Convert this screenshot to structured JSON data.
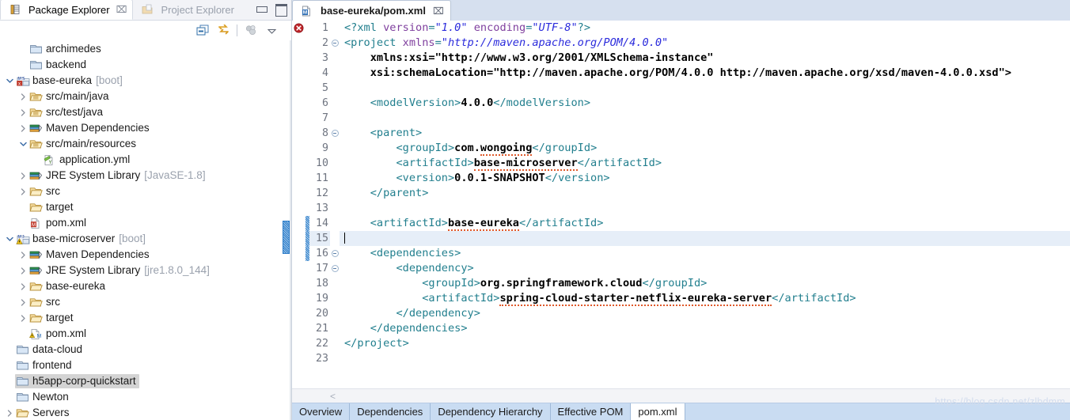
{
  "explorer": {
    "tabs": [
      {
        "label": "Package Explorer",
        "active": true,
        "icon": "package-explorer-icon",
        "close": "⌧"
      },
      {
        "label": "Project Explorer",
        "active": false,
        "icon": "project-explorer-icon",
        "close": "⌧"
      }
    ],
    "window_buttons": [
      {
        "name": "minimize-button",
        "label": ""
      },
      {
        "name": "maximize-button",
        "label": ""
      }
    ],
    "toolbar": [
      {
        "name": "collapse-all-button",
        "title": "Collapse All"
      },
      {
        "name": "link-with-editor-button",
        "title": "Link with Editor"
      },
      {
        "name": "focus-on-active-task-button",
        "title": "Focus on Active Task"
      },
      {
        "name": "view-menu-button",
        "title": "View Menu"
      }
    ],
    "tree": [
      {
        "indent": 1,
        "arrow": "none",
        "icon": "folder-closed-icon",
        "label": "archimedes",
        "sub": "",
        "selected": false
      },
      {
        "indent": 1,
        "arrow": "none",
        "icon": "folder-closed-icon",
        "label": "backend",
        "sub": "",
        "selected": false
      },
      {
        "indent": 0,
        "arrow": "expanded",
        "icon": "maven-spring-project-icon",
        "label": "base-eureka",
        "sub": "[boot]",
        "selected": false
      },
      {
        "indent": 1,
        "arrow": "collapsed",
        "icon": "source-folder-icon",
        "label": "src/main/java",
        "sub": "",
        "selected": false
      },
      {
        "indent": 1,
        "arrow": "collapsed",
        "icon": "source-folder-icon",
        "label": "src/test/java",
        "sub": "",
        "selected": false
      },
      {
        "indent": 1,
        "arrow": "collapsed",
        "icon": "library-icon",
        "label": "Maven Dependencies",
        "sub": "",
        "selected": false
      },
      {
        "indent": 1,
        "arrow": "expanded",
        "icon": "source-folder-icon",
        "label": "src/main/resources",
        "sub": "",
        "selected": false
      },
      {
        "indent": 2,
        "arrow": "none",
        "icon": "yaml-file-icon",
        "label": "application.yml",
        "sub": "",
        "selected": false
      },
      {
        "indent": 1,
        "arrow": "collapsed",
        "icon": "library-icon",
        "label": "JRE System Library",
        "sub": "[JavaSE-1.8]",
        "selected": false
      },
      {
        "indent": 1,
        "arrow": "collapsed",
        "icon": "folder-open-icon",
        "label": "src",
        "sub": "",
        "selected": false
      },
      {
        "indent": 1,
        "arrow": "none",
        "icon": "folder-open-icon",
        "label": "target",
        "sub": "",
        "selected": false
      },
      {
        "indent": 1,
        "arrow": "none",
        "icon": "maven-pom-icon",
        "label": "pom.xml",
        "sub": "",
        "selected": false
      },
      {
        "indent": 0,
        "arrow": "expanded",
        "icon": "maven-warn-project-icon",
        "label": "base-microserver",
        "sub": "[boot]",
        "selected": false
      },
      {
        "indent": 1,
        "arrow": "collapsed",
        "icon": "library-icon",
        "label": "Maven Dependencies",
        "sub": "",
        "selected": false
      },
      {
        "indent": 1,
        "arrow": "collapsed",
        "icon": "library-icon",
        "label": "JRE System Library",
        "sub": "[jre1.8.0_144]",
        "selected": false
      },
      {
        "indent": 1,
        "arrow": "collapsed",
        "icon": "folder-open-icon",
        "label": "base-eureka",
        "sub": "",
        "selected": false
      },
      {
        "indent": 1,
        "arrow": "collapsed",
        "icon": "folder-open-icon",
        "label": "src",
        "sub": "",
        "selected": false
      },
      {
        "indent": 1,
        "arrow": "collapsed",
        "icon": "folder-open-icon",
        "label": "target",
        "sub": "",
        "selected": false
      },
      {
        "indent": 1,
        "arrow": "none",
        "icon": "maven-warn-pom-icon",
        "label": "pom.xml",
        "sub": "",
        "selected": false
      },
      {
        "indent": 0,
        "arrow": "none",
        "icon": "folder-closed-icon",
        "label": "data-cloud",
        "sub": "",
        "selected": false
      },
      {
        "indent": 0,
        "arrow": "none",
        "icon": "folder-closed-icon",
        "label": "frontend",
        "sub": "",
        "selected": false
      },
      {
        "indent": 0,
        "arrow": "none",
        "icon": "folder-closed-icon",
        "label": "h5app-corp-quickstart",
        "sub": "",
        "selected": true
      },
      {
        "indent": 0,
        "arrow": "none",
        "icon": "folder-closed-icon",
        "label": "Newton",
        "sub": "",
        "selected": false
      },
      {
        "indent": 0,
        "arrow": "collapsed",
        "icon": "folder-open-icon",
        "label": "Servers",
        "sub": "",
        "selected": false
      }
    ]
  },
  "editor": {
    "tab": {
      "label": "base-eureka/pom.xml",
      "icon": "maven-pom-icon",
      "close": "⌧",
      "dirty": false
    },
    "gutter_hint": "<",
    "error_marker_line": 1,
    "current_line": 15,
    "changed_lines": [
      14,
      15,
      16
    ],
    "foldable_lines": [
      2,
      8,
      16,
      17
    ],
    "lines": [
      {
        "n": 1,
        "content": "<?xml version=\"1.0\" encoding=\"UTF-8\"?>"
      },
      {
        "n": 2,
        "content": "<project xmlns=\"http://maven.apache.org/POM/4.0.0\""
      },
      {
        "n": 3,
        "content": "    xmlns:xsi=\"http://www.w3.org/2001/XMLSchema-instance\""
      },
      {
        "n": 4,
        "content": "    xsi:schemaLocation=\"http://maven.apache.org/POM/4.0.0 http://maven.apache.org/xsd/maven-4.0.0.xsd\">"
      },
      {
        "n": 5,
        "content": ""
      },
      {
        "n": 6,
        "content": "    <modelVersion>4.0.0</modelVersion>"
      },
      {
        "n": 7,
        "content": ""
      },
      {
        "n": 8,
        "content": "    <parent>"
      },
      {
        "n": 9,
        "content": "        <groupId>com.wongoing</groupId>"
      },
      {
        "n": 10,
        "content": "        <artifactId>base-microserver</artifactId>"
      },
      {
        "n": 11,
        "content": "        <version>0.0.1-SNAPSHOT</version>"
      },
      {
        "n": 12,
        "content": "    </parent>"
      },
      {
        "n": 13,
        "content": ""
      },
      {
        "n": 14,
        "content": "    <artifactId>base-eureka</artifactId>"
      },
      {
        "n": 15,
        "content": ""
      },
      {
        "n": 16,
        "content": "    <dependencies>"
      },
      {
        "n": 17,
        "content": "        <dependency>"
      },
      {
        "n": 18,
        "content": "            <groupId>org.springframework.cloud</groupId>"
      },
      {
        "n": 19,
        "content": "            <artifactId>spring-cloud-starter-netflix-eureka-server</artifactId>"
      },
      {
        "n": 20,
        "content": "        </dependency>"
      },
      {
        "n": 21,
        "content": "    </dependencies>"
      },
      {
        "n": 22,
        "content": "</project>"
      },
      {
        "n": 23,
        "content": ""
      }
    ],
    "form_tabs": [
      {
        "label": "Overview",
        "selected": false
      },
      {
        "label": "Dependencies",
        "selected": false
      },
      {
        "label": "Dependency Hierarchy",
        "selected": false
      },
      {
        "label": "Effective POM",
        "selected": false
      },
      {
        "label": "pom.xml",
        "selected": true
      }
    ]
  },
  "watermark": "https://blog.csdn.net/zlbdmm",
  "colors": {
    "tag": "#227f8e",
    "attribute": "#7f3f9e",
    "string": "#2b2bdc",
    "text": "#000000",
    "current_line_bg": "#e6eef8",
    "selection_bg": "#d4d4d4",
    "editor_tabbar_bg": "#d6e0ef",
    "form_tabs_bg": "#c9dcf2",
    "change_bar": "#2f7ec9"
  }
}
